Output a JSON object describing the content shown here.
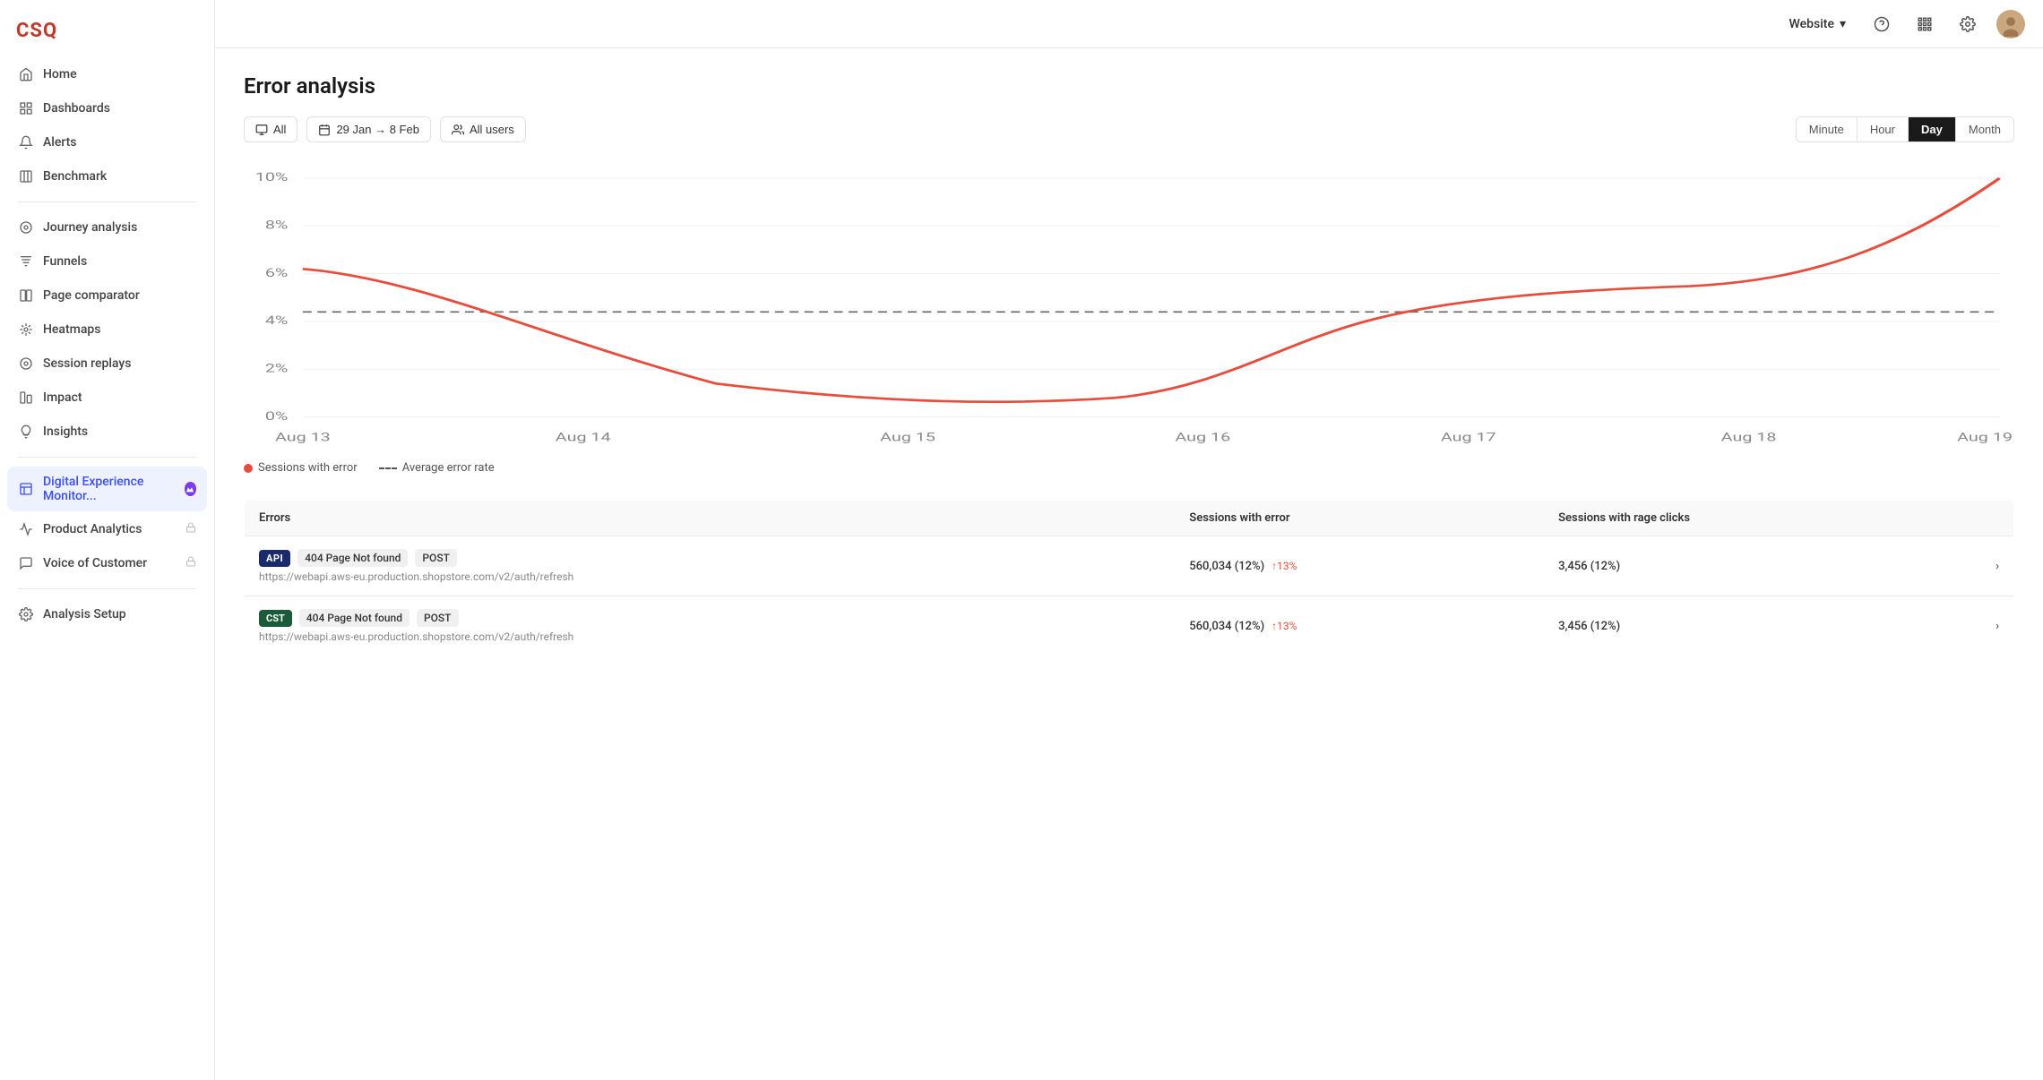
{
  "app": {
    "logo": "CSQ"
  },
  "topbar": {
    "website_label": "Website",
    "chevron": "▾"
  },
  "sidebar": {
    "items": [
      {
        "id": "home",
        "label": "Home",
        "icon": "🏠",
        "active": false
      },
      {
        "id": "dashboards",
        "label": "Dashboards",
        "icon": "⊞",
        "active": false
      },
      {
        "id": "alerts",
        "label": "Alerts",
        "icon": "🔔",
        "active": false
      },
      {
        "id": "benchmark",
        "label": "Benchmark",
        "icon": "⊡",
        "active": false
      },
      {
        "id": "journey-analysis",
        "label": "Journey analysis",
        "icon": "◎",
        "active": false
      },
      {
        "id": "funnels",
        "label": "Funnels",
        "icon": "📊",
        "active": false
      },
      {
        "id": "page-comparator",
        "label": "Page comparator",
        "icon": "⊟",
        "active": false
      },
      {
        "id": "heatmaps",
        "label": "Heatmaps",
        "icon": "✳",
        "active": false
      },
      {
        "id": "session-replays",
        "label": "Session replays",
        "icon": "⊙",
        "active": false
      },
      {
        "id": "impact",
        "label": "Impact",
        "icon": "⊞",
        "active": false
      },
      {
        "id": "insights",
        "label": "Insights",
        "icon": "💡",
        "active": false
      },
      {
        "id": "digital-experience",
        "label": "Digital Experience Monitor...",
        "icon": "⊟",
        "active": true
      },
      {
        "id": "product-analytics",
        "label": "Product Analytics",
        "icon": "📈",
        "active": false
      },
      {
        "id": "voice-of-customer",
        "label": "Voice of Customer",
        "icon": "💬",
        "active": false
      },
      {
        "id": "analysis-setup",
        "label": "Analysis Setup",
        "icon": "⚙",
        "active": false
      }
    ]
  },
  "page": {
    "title": "Error analysis"
  },
  "filters": {
    "all_label": "All",
    "date_range": "29 Jan → 8 Feb",
    "users_label": "All users"
  },
  "time_buttons": [
    {
      "id": "minute",
      "label": "Minute",
      "active": false
    },
    {
      "id": "hour",
      "label": "Hour",
      "active": false
    },
    {
      "id": "day",
      "label": "Day",
      "active": true
    },
    {
      "id": "month",
      "label": "Month",
      "active": false
    }
  ],
  "chart": {
    "x_labels": [
      "Aug 13",
      "Aug 14",
      "Aug 15",
      "Aug 16",
      "Aug 17",
      "Aug 18",
      "Aug 19"
    ],
    "y_labels": [
      "10%",
      "8%",
      "6%",
      "4%",
      "2%",
      "0%"
    ],
    "legend": {
      "series1": "Sessions with error",
      "series2": "Average error rate"
    }
  },
  "table": {
    "headers": [
      "Errors",
      "Sessions with error",
      "Sessions with rage clicks"
    ],
    "rows": [
      {
        "badge_type": "API",
        "badge_color": "api",
        "error_type": "404 Page Not found",
        "method": "POST",
        "url": "https://webapi.aws-eu.production.shopstore.com/v2/auth/refresh",
        "sessions": "560,034 (12%)",
        "trend": "↑13%",
        "rage_clicks": "3,456 (12%)"
      },
      {
        "badge_type": "CST",
        "badge_color": "cst",
        "error_type": "404 Page Not found",
        "method": "POST",
        "url": "https://webapi.aws-eu.production.shopstore.com/v2/auth/refresh",
        "sessions": "560,034 (12%)",
        "trend": "↑13%",
        "rage_clicks": "3,456 (12%)"
      }
    ]
  }
}
